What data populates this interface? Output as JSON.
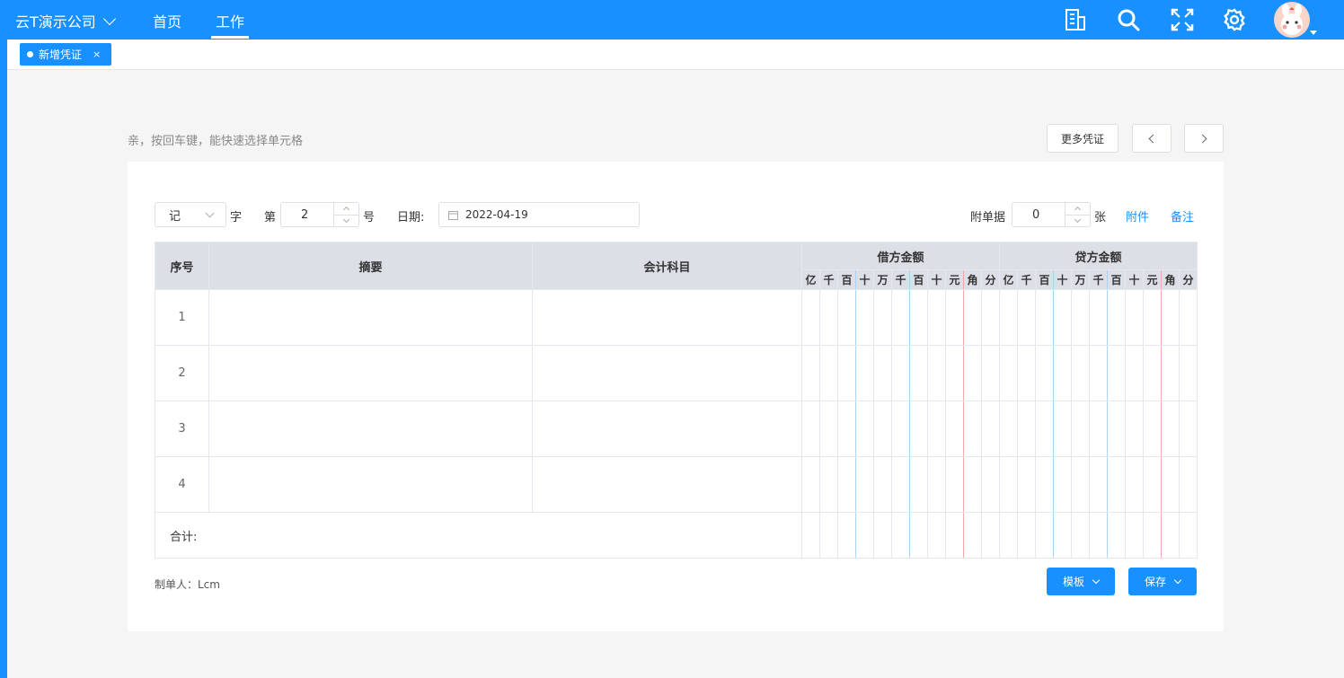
{
  "header": {
    "company": "云T演示公司",
    "nav": [
      "首页",
      "工作"
    ],
    "icons": [
      "building-icon",
      "search-icon",
      "fullscreen-icon",
      "gear-icon"
    ]
  },
  "tabs": [
    {
      "label": "新增凭证",
      "close": "×"
    }
  ],
  "hint": "亲，按回车键，能快速选择单元格",
  "top_buttons": {
    "more": "更多凭证"
  },
  "form": {
    "word_select": "记",
    "word_label": "字",
    "number_prefix": "第",
    "number_value": "2",
    "number_suffix": "号",
    "date_label": "日期:",
    "date_value": "2022-04-19",
    "attach_label": "附单据",
    "attach_value": "0",
    "attach_unit": "张",
    "attachment_link": "附件",
    "remark_link": "备注"
  },
  "table": {
    "col_index": "序号",
    "col_summary": "摘要",
    "col_account": "会计科目",
    "col_debit": "借方金额",
    "col_credit": "贷方金额",
    "digits": [
      "亿",
      "千",
      "百",
      "十",
      "万",
      "千",
      "百",
      "十",
      "元",
      "角",
      "分"
    ],
    "rows": [
      "1",
      "2",
      "3",
      "4"
    ],
    "total_label": "合计:"
  },
  "footer": {
    "maker": "制单人：Lcm",
    "template_button": "模板",
    "save_button": "保存"
  },
  "colors": {
    "primary": "#1890ff",
    "header_bg": "#dcdfe6"
  }
}
